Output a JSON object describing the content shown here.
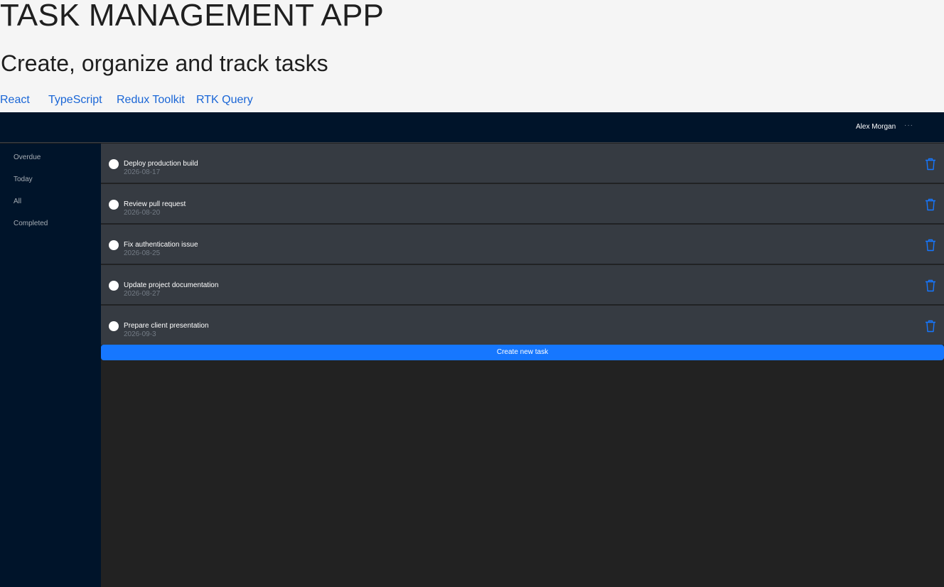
{
  "header": {
    "title": "TASK MANAGEMENT APP",
    "subtitle": "Create, organize and track tasks",
    "tech_links": [
      "React",
      "TypeScript",
      "Redux Toolkit",
      "RTK Query"
    ]
  },
  "topbar": {
    "user_name": "Alex Morgan",
    "more_icon": "more-horizontal-icon",
    "more_glyph": "···"
  },
  "sidebar": {
    "items": [
      "Overdue",
      "Today",
      "All",
      "Completed"
    ]
  },
  "tasks": [
    {
      "title": "Deploy production build",
      "date": "2026-08-17"
    },
    {
      "title": "Review pull request",
      "date": "2026-08-20"
    },
    {
      "title": "Fix authentication issue",
      "date": "2026-08-25"
    },
    {
      "title": "Update project documentation",
      "date": "2026-08-27"
    },
    {
      "title": "Prepare client presentation",
      "date": "2026-09-3"
    }
  ],
  "actions": {
    "create_label": "Create new task"
  },
  "icons": {
    "task_check": "circle-check-icon",
    "delete": "trash-icon"
  },
  "colors": {
    "accent": "#1677ff",
    "link": "#1a66d6",
    "nav_bg": "#00142a",
    "row_bg": "#363b42",
    "content_bg": "#222222"
  }
}
